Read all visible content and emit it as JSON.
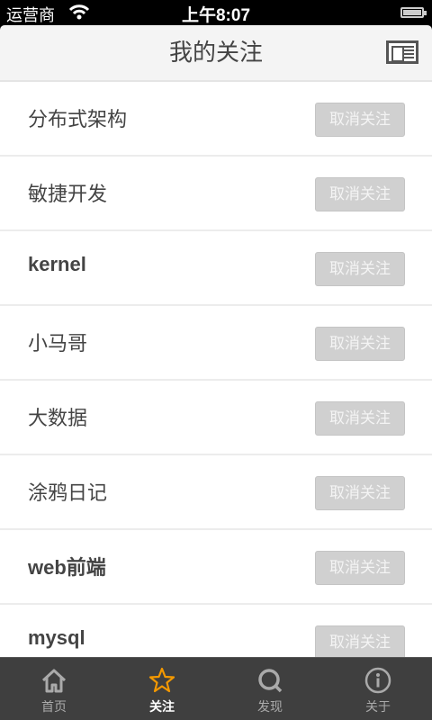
{
  "status": {
    "carrier": "运营商",
    "time": "上午8:07"
  },
  "header": {
    "title": "我的关注"
  },
  "items": [
    {
      "name": "分布式架构",
      "action": "取消关注"
    },
    {
      "name": "敏捷开发",
      "action": "取消关注"
    },
    {
      "name": "kernel",
      "action": "取消关注"
    },
    {
      "name": "小马哥",
      "action": "取消关注"
    },
    {
      "name": "大数据",
      "action": "取消关注"
    },
    {
      "name": "涂鸦日记",
      "action": "取消关注"
    },
    {
      "name": "web前端",
      "action": "取消关注"
    },
    {
      "name": "mysql",
      "action": "取消关注"
    }
  ],
  "tabs": [
    {
      "label": "首页",
      "icon": "home-icon"
    },
    {
      "label": "关注",
      "icon": "star-icon",
      "active": true
    },
    {
      "label": "发现",
      "icon": "search-icon"
    },
    {
      "label": "关于",
      "icon": "info-icon"
    }
  ],
  "colors": {
    "accent": "#f39800",
    "tabbar": "#3f3f3f",
    "button": "#d0d0d0"
  }
}
